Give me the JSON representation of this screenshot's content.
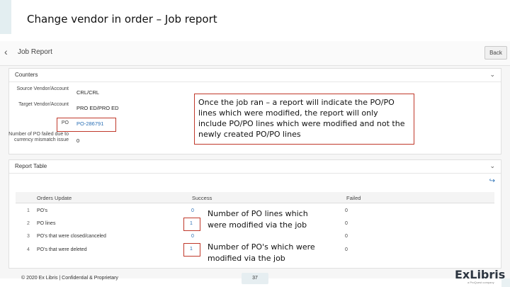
{
  "slide": {
    "title": "Change vendor in order – Job report"
  },
  "header": {
    "title": "Job Report",
    "back_button": "Back"
  },
  "counters": {
    "title": "Counters",
    "rows": [
      {
        "label": "Source Vendor/Account",
        "value": "CRL/CRL"
      },
      {
        "label": "Target Vendor/Account",
        "value": "PRO ED/PRO ED"
      },
      {
        "label": "PO",
        "value": "PO-286791"
      },
      {
        "label": "Number of PO failed due to currency mismatch issue",
        "value": "0"
      }
    ]
  },
  "callout": {
    "text": "Once the job ran – a report will indicate the PO/PO lines which were modified, the report will only include PO/PO lines which were modified and not the newly created PO/PO lines"
  },
  "report_table": {
    "title": "Report Table",
    "columns": [
      "Orders Update",
      "Success",
      "Failed"
    ],
    "rows": [
      {
        "num": "1",
        "label": "PO's",
        "success": "0",
        "failed": "0"
      },
      {
        "num": "2",
        "label": "PO lines",
        "success": "1",
        "failed": "0"
      },
      {
        "num": "3",
        "label": "PO's that were closed/canceled",
        "success": "0",
        "failed": "0"
      },
      {
        "num": "4",
        "label": "PO's that were deleted",
        "success": "1",
        "failed": "0"
      }
    ]
  },
  "annotations": {
    "po_lines": "Number of PO lines which were modified via the job",
    "pos": "Number of PO's which were modified via the job"
  },
  "footer": {
    "copyright": "© 2020 Ex Libris | Confidential & Proprietary",
    "page": "37"
  },
  "logo": {
    "text": "ExLibris",
    "tagline": "a ProQuest company"
  },
  "colors": {
    "highlight": "#c0392b",
    "link": "#2a6fb5"
  },
  "icons": {
    "back": "chevron-left-icon",
    "collapse": "chevron-down-icon",
    "export": "export-icon"
  }
}
